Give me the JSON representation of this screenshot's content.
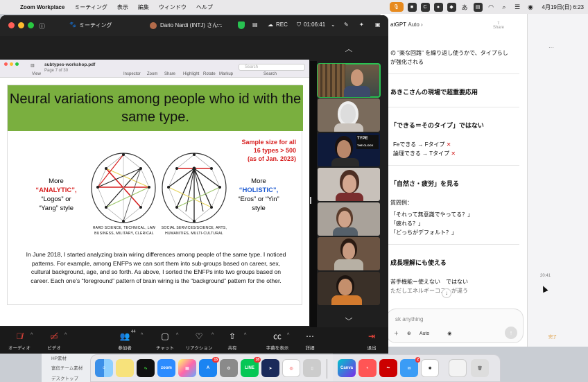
{
  "menubar": {
    "app_name": "Zoom Workplace",
    "items": [
      "ミーティング",
      "表示",
      "編集",
      "ウィンドウ",
      "ヘルプ"
    ],
    "status_letter": "あ",
    "clock": "4月19日(日) 6:23"
  },
  "zoom": {
    "title_meeting": "ミーティング",
    "participant_name": "Dario Nardi (INTJ) さん...",
    "rec_label": "REC",
    "timer": "01:06:41"
  },
  "pdf_viewer": {
    "file_name": "subtypes-workshop.pdf",
    "page_info": "Page 7 of 30",
    "toolbar": [
      "View",
      "Inspector",
      "Zoom",
      "Share",
      "Highlight",
      "Rotate",
      "Markup",
      "Search"
    ],
    "search_placeholder": "Search"
  },
  "slide": {
    "title": "Neural variations among people who id with the same type.",
    "sample_line1": "Sample size for all",
    "sample_line2": "16 types > 500",
    "sample_line3": "(as of Jan. 2023)",
    "left_more": "More",
    "left_analytic": "“ANALYTIC”,",
    "left_logos": "“Logos” or",
    "left_yang": "“Yang” style",
    "right_more": "More",
    "right_holistic": "“HOLISTIC”,",
    "right_eros": "“Eros” or “Yin”",
    "right_style": "style",
    "caption_left_1": "HARD SCIENCE, TECHNICAL, LAW",
    "caption_left_2": "BUSINESS, MILITARY, CLERICAL",
    "caption_right_1": "SOCIAL SERVICES/SCIENCE, ARTS,",
    "caption_right_2": "HUMANITIES, MULTI-CULTURAL",
    "paragraph": "In June 2018, I started analyzing brain wiring differences among people of the same type. I noticed patterns. For example, among ENFPs we can sort them into sub-groups based on career, sex, cultural background, age, and so forth. As above, I sorted the ENFPs into two groups based on career. Each one’s “foreground” pattern of brain wiring is the “background” pattern for the other."
  },
  "controls": {
    "audio": "オーディオ",
    "video": "ビデオ",
    "participants": "参加者",
    "participants_count": "44",
    "chat": "チャット",
    "reactions": "リアクション",
    "share": "共有",
    "captions": "字幕を表示",
    "more": "詳細",
    "leave": "退出"
  },
  "chatgpt": {
    "title": "atGPT",
    "model": "Auto",
    "share_label": "Share",
    "lines": [
      "の \"楽な回路\" を繰り返し使うかで、タイプらし",
      "が強化される"
    ],
    "section1": "あきこさんの現場で超重要応用",
    "section2": "「できる＝そのタイプ」ではない",
    "fe_line": "Feできる → Fタイプ",
    "logic_line": "論理できる → Tタイプ",
    "x_mark": "✕",
    "section3": "「自然さ・疲労」を見る",
    "question_example": "質問例：",
    "q1": "「それって無意識でやってる？」",
    "q2": "「疲れる？」",
    "q3": "「どっちがデフォルト？」",
    "section4": "成長理解にも使える",
    "weak": "苦手機能＝使えない　ではない",
    "energy": "ただしエネルギーコストが違う",
    "input_placeholder": "sk anything",
    "input_mode": "Auto"
  },
  "right_window": {
    "time": "20:41",
    "done": "完了"
  },
  "finder": {
    "item1": "HP素材",
    "item2": "富伝チーム素材",
    "item3": "デスクトップ"
  },
  "dock": {
    "zoom_label": "zoom",
    "canva_label": "Canva",
    "line_label": "LINE",
    "badge_appstore": "15",
    "badge_line": "18",
    "badge_mail": "2"
  }
}
